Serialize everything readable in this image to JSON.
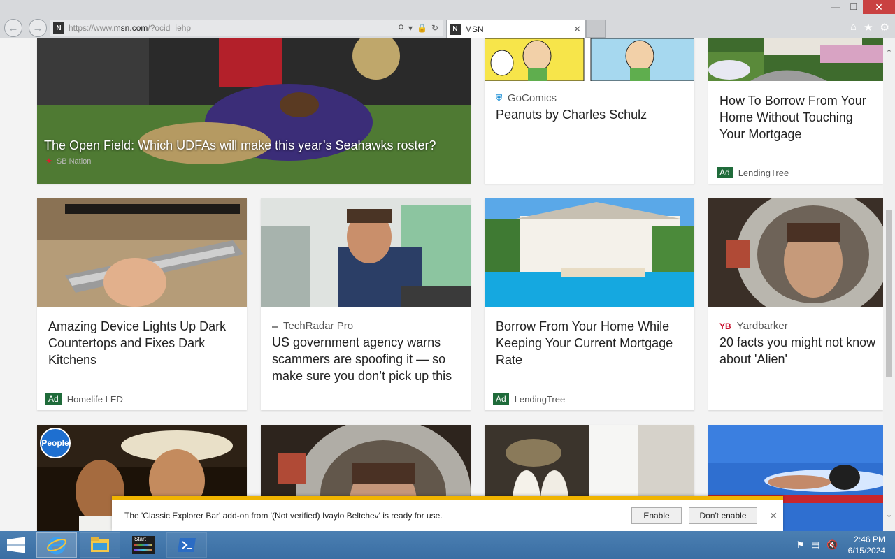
{
  "browser": {
    "address_prefix": "https://www.",
    "address_domain": "msn.com",
    "address_suffix": "/?ocid=iehp",
    "tab_title": "MSN",
    "favicon_letter": "N"
  },
  "hero": {
    "title": "The Open Field: Which UDFAs will make this year’s Seahawks roster?",
    "source": "SB Nation"
  },
  "cards_top": [
    {
      "source": "GoComics",
      "title": "Peanuts by Charles Schulz"
    },
    {
      "title": "How To Borrow From Your Home Without Touching Your Mortgage",
      "ad_label": "Ad",
      "advertiser": "LendingTree"
    }
  ],
  "cards_row2": [
    {
      "title": "Amazing Device Lights Up Dark Countertops and Fixes Dark Kitchens",
      "ad_label": "Ad",
      "advertiser": "Homelife LED"
    },
    {
      "source": "TechRadar Pro",
      "title": "US government agency warns scammers are spoofing it — so make sure you don’t pick up this"
    },
    {
      "title": "Borrow From Your Home While Keeping Your Current Mortgage Rate",
      "ad_label": "Ad",
      "advertiser": "LendingTree"
    },
    {
      "source": "Yardbarker",
      "source_logo": "YB",
      "title": "20 facts you might not know about 'Alien'"
    }
  ],
  "people_badge": "People",
  "notification": {
    "message": "The 'Classic Explorer Bar' add-on from '(Not verified) Ivaylo Beltchev' is ready for use.",
    "enable_label": "Enable",
    "dont_enable_label": "Don't enable"
  },
  "taskbar": {
    "start_tile_label": "Start",
    "time": "2:46 PM",
    "date": "6/15/2024"
  },
  "colors": {
    "accent_notify": "#f0b400",
    "ad_badge": "#1f6b3a",
    "taskbar": "#3a6ea3"
  }
}
